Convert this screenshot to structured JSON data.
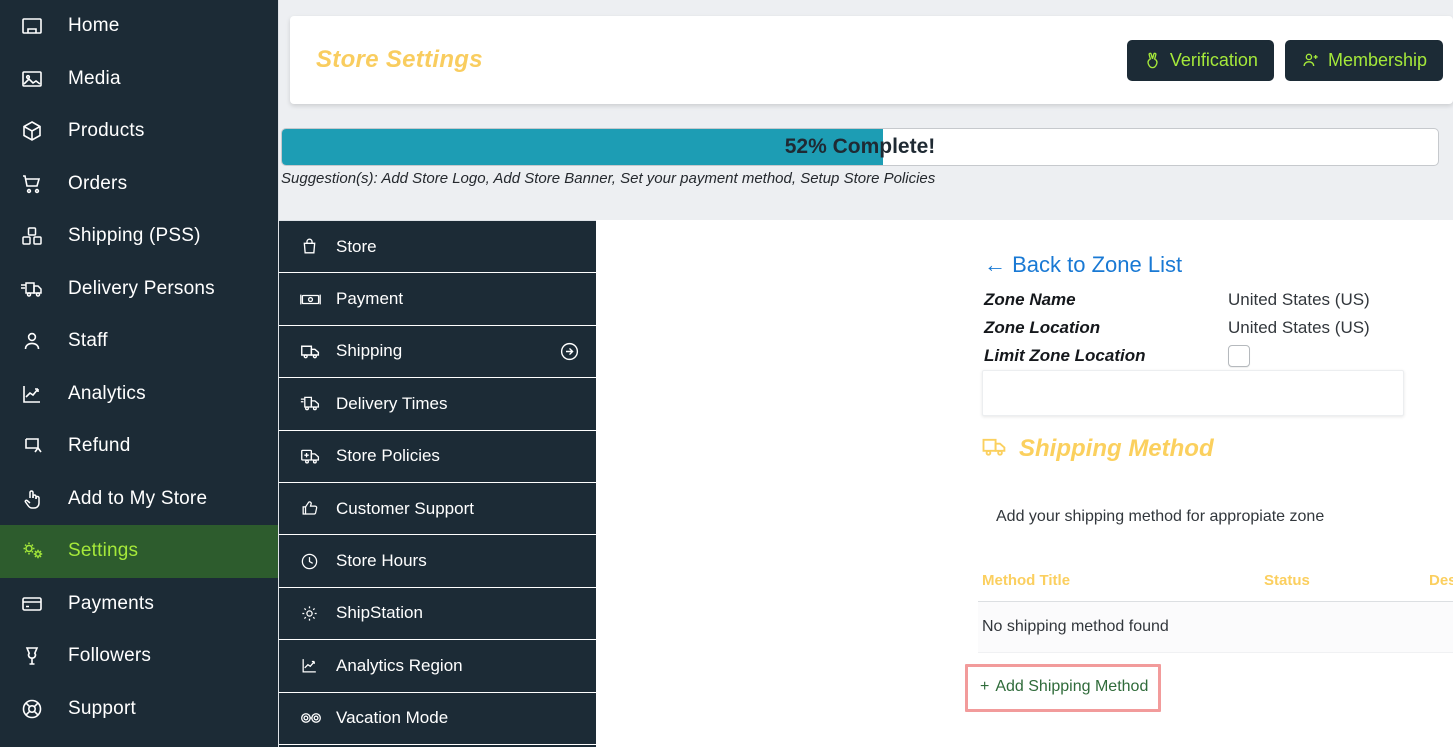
{
  "sidebar": {
    "items": [
      {
        "label": "Home",
        "icon": "home-icon",
        "active": false
      },
      {
        "label": "Media",
        "icon": "image-icon",
        "active": false
      },
      {
        "label": "Products",
        "icon": "box-icon",
        "active": false
      },
      {
        "label": "Orders",
        "icon": "cart-icon",
        "active": false
      },
      {
        "label": "Shipping (PSS)",
        "icon": "packages-icon",
        "active": false
      },
      {
        "label": "Delivery Persons",
        "icon": "delivery-truck-icon",
        "active": false
      },
      {
        "label": "Staff",
        "icon": "user-icon",
        "active": false
      },
      {
        "label": "Analytics",
        "icon": "chart-line-icon",
        "active": false
      },
      {
        "label": "Refund",
        "icon": "return-arrow-icon",
        "active": false
      },
      {
        "label": "Add to My Store",
        "icon": "hand-pointer-icon",
        "active": false
      },
      {
        "label": "Settings",
        "icon": "gears-icon",
        "active": true
      },
      {
        "label": "Payments",
        "icon": "credit-card-icon",
        "active": false
      },
      {
        "label": "Followers",
        "icon": "followers-icon",
        "active": false
      },
      {
        "label": "Support",
        "icon": "lifebuoy-icon",
        "active": false
      }
    ]
  },
  "header": {
    "title": "Store Settings",
    "verification_label": "Verification",
    "membership_label": "Membership",
    "accent_color": "#a5e93a",
    "title_color": "#f9cd5f"
  },
  "progress": {
    "percent": 52,
    "text": "52% Complete!",
    "fill_color": "#1d9db4",
    "suggestions": "Suggestion(s): Add Store Logo, Add Store Banner, Set your payment method, Setup Store Policies"
  },
  "settings_menu": {
    "items": [
      {
        "label": "Store",
        "icon": "shopping-bag-icon",
        "arrow": false
      },
      {
        "label": "Payment",
        "icon": "banknote-icon",
        "arrow": false
      },
      {
        "label": "Shipping",
        "icon": "truck-icon",
        "arrow": true
      },
      {
        "label": "Delivery Times",
        "icon": "delivery-time-icon",
        "arrow": false
      },
      {
        "label": "Store Policies",
        "icon": "policy-truck-icon",
        "arrow": false
      },
      {
        "label": "Customer Support",
        "icon": "thumbs-up-icon",
        "arrow": false
      },
      {
        "label": "Store Hours",
        "icon": "clock-icon",
        "arrow": false
      },
      {
        "label": "ShipStation",
        "icon": "gear-icon",
        "arrow": false
      },
      {
        "label": "Analytics Region",
        "icon": "chart-line-icon",
        "arrow": false
      },
      {
        "label": "Vacation Mode",
        "icon": "sunglasses-icon",
        "arrow": false
      }
    ]
  },
  "content": {
    "back_link": "← Back to Zone List",
    "zone_name_label": "Zone Name",
    "zone_name_value": "United States (US)",
    "zone_location_label": "Zone Location",
    "zone_location_value": "United States (US)",
    "limit_zone_label": "Limit Zone Location",
    "limit_zone_checked": false,
    "zone_input_value": "",
    "shipping_method_heading": "Shipping Method",
    "shipping_method_sub": "Add your shipping method for appropiate zone",
    "table": {
      "headers": [
        "Method Title",
        "Status",
        "Description"
      ],
      "empty_text": "No shipping method found",
      "rows": []
    },
    "add_method_label": "Add Shipping Method",
    "add_method_plus": "+"
  }
}
